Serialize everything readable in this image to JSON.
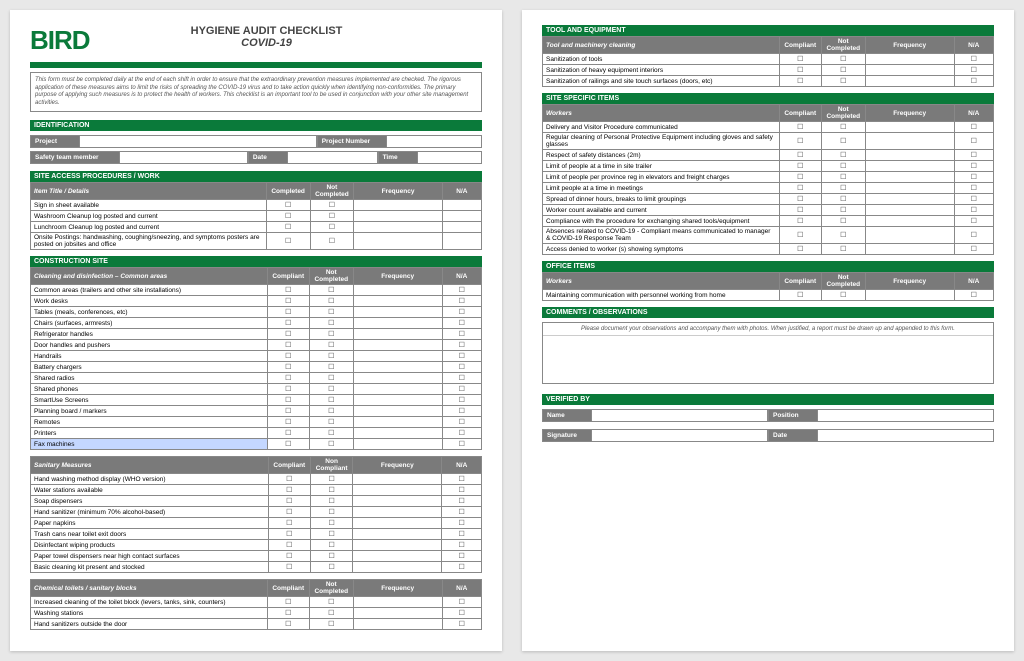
{
  "logo": "BIRD",
  "title": "HYGIENE AUDIT CHECKLIST",
  "subtitle": "COVID-19",
  "intro": "This form must be completed daily at the end of each shift in order to ensure that the extraordinary prevention measures implemented are checked. The rigorous application of these measures aims to limit the risks of spreading the COVID-19 virus and to take action quickly when identifying non-conformities. The primary purpose of applying such measures is to protect the health of workers. This checklist is an important tool to be used in conjunction with your other site management activities.",
  "identification": {
    "heading": "IDENTIFICATION",
    "project": "Project",
    "project_number": "Project Number",
    "safety_member": "Safety team member",
    "date": "Date",
    "time": "Time"
  },
  "cols": {
    "item": "Item Title / Details",
    "completed": "Completed",
    "not_completed": "Not Completed",
    "compliant": "Compliant",
    "non_compliant": "Non Compliant",
    "frequency": "Frequency",
    "na": "N/A"
  },
  "site_access": {
    "heading": "SITE ACCESS PROCEDURES / WORK",
    "items": [
      "Sign in sheet available",
      "Washroom Cleanup log posted and current",
      "Lunchroom Cleanup log posted and current",
      "Onsite Postings: handwashing, coughing/sneezing, and symptoms posters are posted on jobsites and office"
    ]
  },
  "construction": {
    "heading": "CONSTRUCTION SITE",
    "sub1": "Cleaning and disinfection – Common areas",
    "items1": [
      "Common areas (trailers and other site installations)",
      "Work desks",
      "Tables (meals, conferences, etc)",
      "Chairs (surfaces, armrests)",
      "Refrigerator handles",
      "Door handles and pushers",
      "Handrails",
      "Battery chargers",
      "Shared radios",
      "Shared phones",
      "SmartUse Screens",
      "Planning board / markers",
      "Remotes",
      "Printers",
      "Fax machines"
    ],
    "sub2": "Sanitary Measures",
    "items2": [
      "Hand washing method display (WHO version)",
      "Water stations available",
      "Soap dispensers",
      "Hand sanitizer (minimum 70% alcohol-based)",
      "Paper napkins",
      "Trash cans near toilet exit doors",
      "Disinfectant wiping products",
      "Paper towel dispensers near high contact surfaces",
      "Basic cleaning kit present and stocked"
    ],
    "sub3": "Chemical toilets / sanitary blocks",
    "items3": [
      "Increased cleaning of the toilet block (levers, tanks, sink, counters)",
      "Washing stations",
      "Hand sanitizers outside the door"
    ]
  },
  "tool": {
    "heading": "TOOL AND EQUIPMENT",
    "sub": "Tool and machinery cleaning",
    "items": [
      "Sanitization of tools",
      "Sanitization of heavy equipment interiors",
      "Sanitization of railings and site touch surfaces (doors, etc)"
    ]
  },
  "site_specific": {
    "heading": "SITE SPECIFIC ITEMS",
    "sub": "Workers",
    "items": [
      "Delivery and Visitor Procedure communicated",
      "Regular cleaning of Personal Protective Equipment including gloves and safety glasses",
      "Respect of safety distances (2m)",
      "Limit of people at a time in site trailer",
      "Limit of people per province reg in elevators and freight charges",
      "Limit  people at a time in meetings",
      "Spread of dinner hours, breaks to limit groupings",
      "Worker count available  and current",
      "Compliance with the procedure for exchanging shared tools/equipment",
      "Absences related to COVID-19 - Compliant means communicated to manager & COVID-19 Response Team",
      "Access denied to worker (s) showing symptoms"
    ]
  },
  "office": {
    "heading": "OFFICE ITEMS",
    "sub": "Workers",
    "items": [
      "Maintaining communication with personnel working from home"
    ]
  },
  "comments": {
    "heading": "COMMENTS / OBSERVATIONS",
    "hint": "Please document your observations and accompany them with photos. When justified, a report must be drawn up and appended to this form."
  },
  "verified": {
    "heading": "VERIFIED BY",
    "name": "Name",
    "position": "Position",
    "signature": "Signature",
    "date": "Date"
  }
}
